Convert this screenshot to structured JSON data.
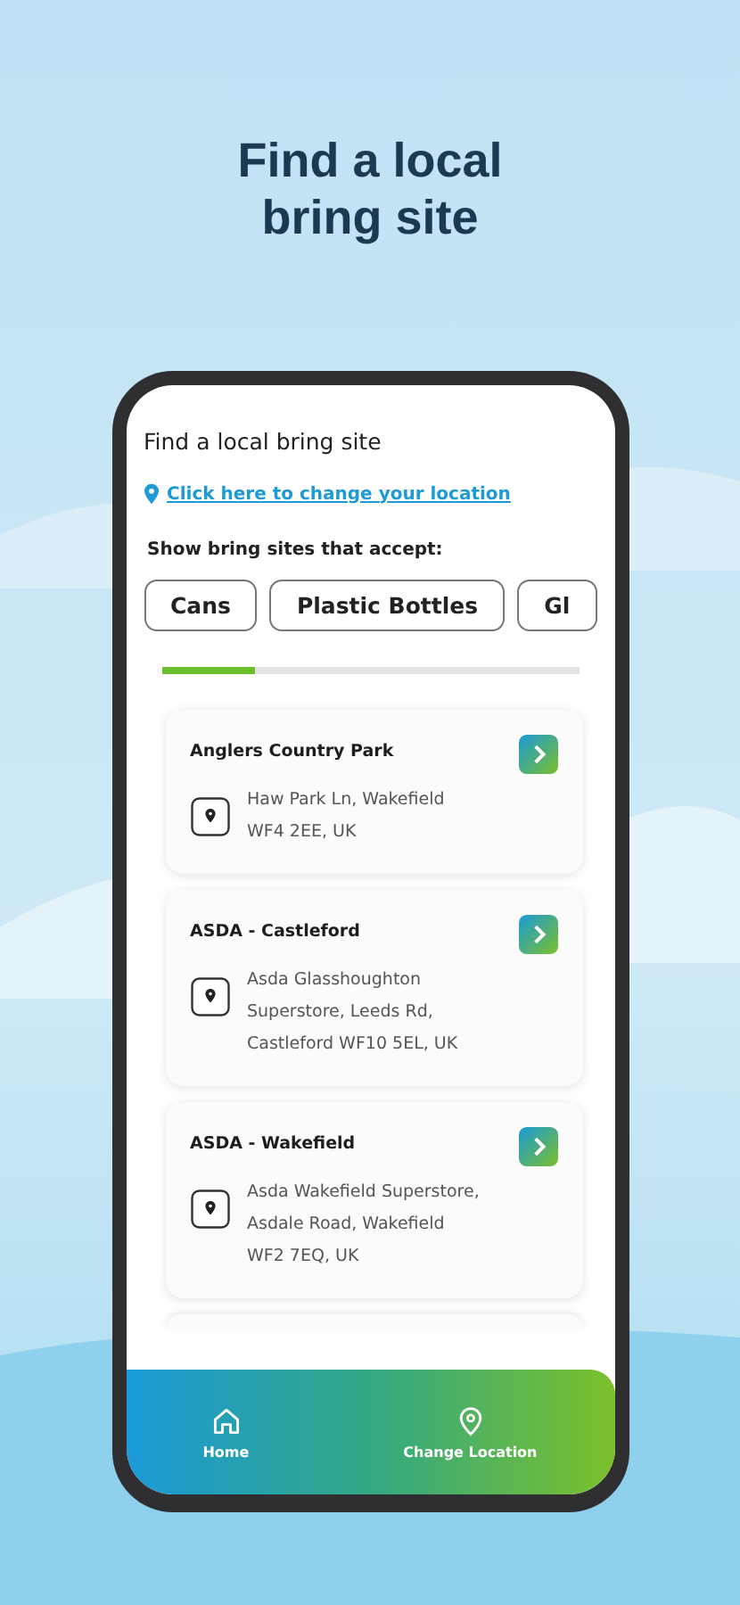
{
  "headline": "Find a local bring site",
  "screen": {
    "title": "Find a local bring site",
    "location_link": "Click here to change your location",
    "filter_label": "Show bring sites that accept:"
  },
  "filters": [
    {
      "label": "Cans"
    },
    {
      "label": "Plastic Bottles"
    },
    {
      "label": "Gl"
    }
  ],
  "sites": [
    {
      "kind": "full",
      "name": "Anglers Country Park",
      "address": [
        "Haw Park Ln, Wakefield",
        "WF4 2EE, UK"
      ]
    },
    {
      "kind": "full",
      "name": "ASDA - Castleford",
      "address": [
        "Asda Glasshoughton",
        "Superstore, Leeds Rd,",
        "Castleford WF10 5EL, UK"
      ]
    },
    {
      "kind": "full",
      "name": "ASDA - Wakefield",
      "address": [
        "Asda Wakefield Superstore,",
        "Asdale Road, Wakefield",
        "WF2 7EQ, UK"
      ]
    },
    {
      "kind": "partial"
    }
  ],
  "nav": [
    {
      "label": "Home"
    },
    {
      "label": "Change Location"
    }
  ]
}
